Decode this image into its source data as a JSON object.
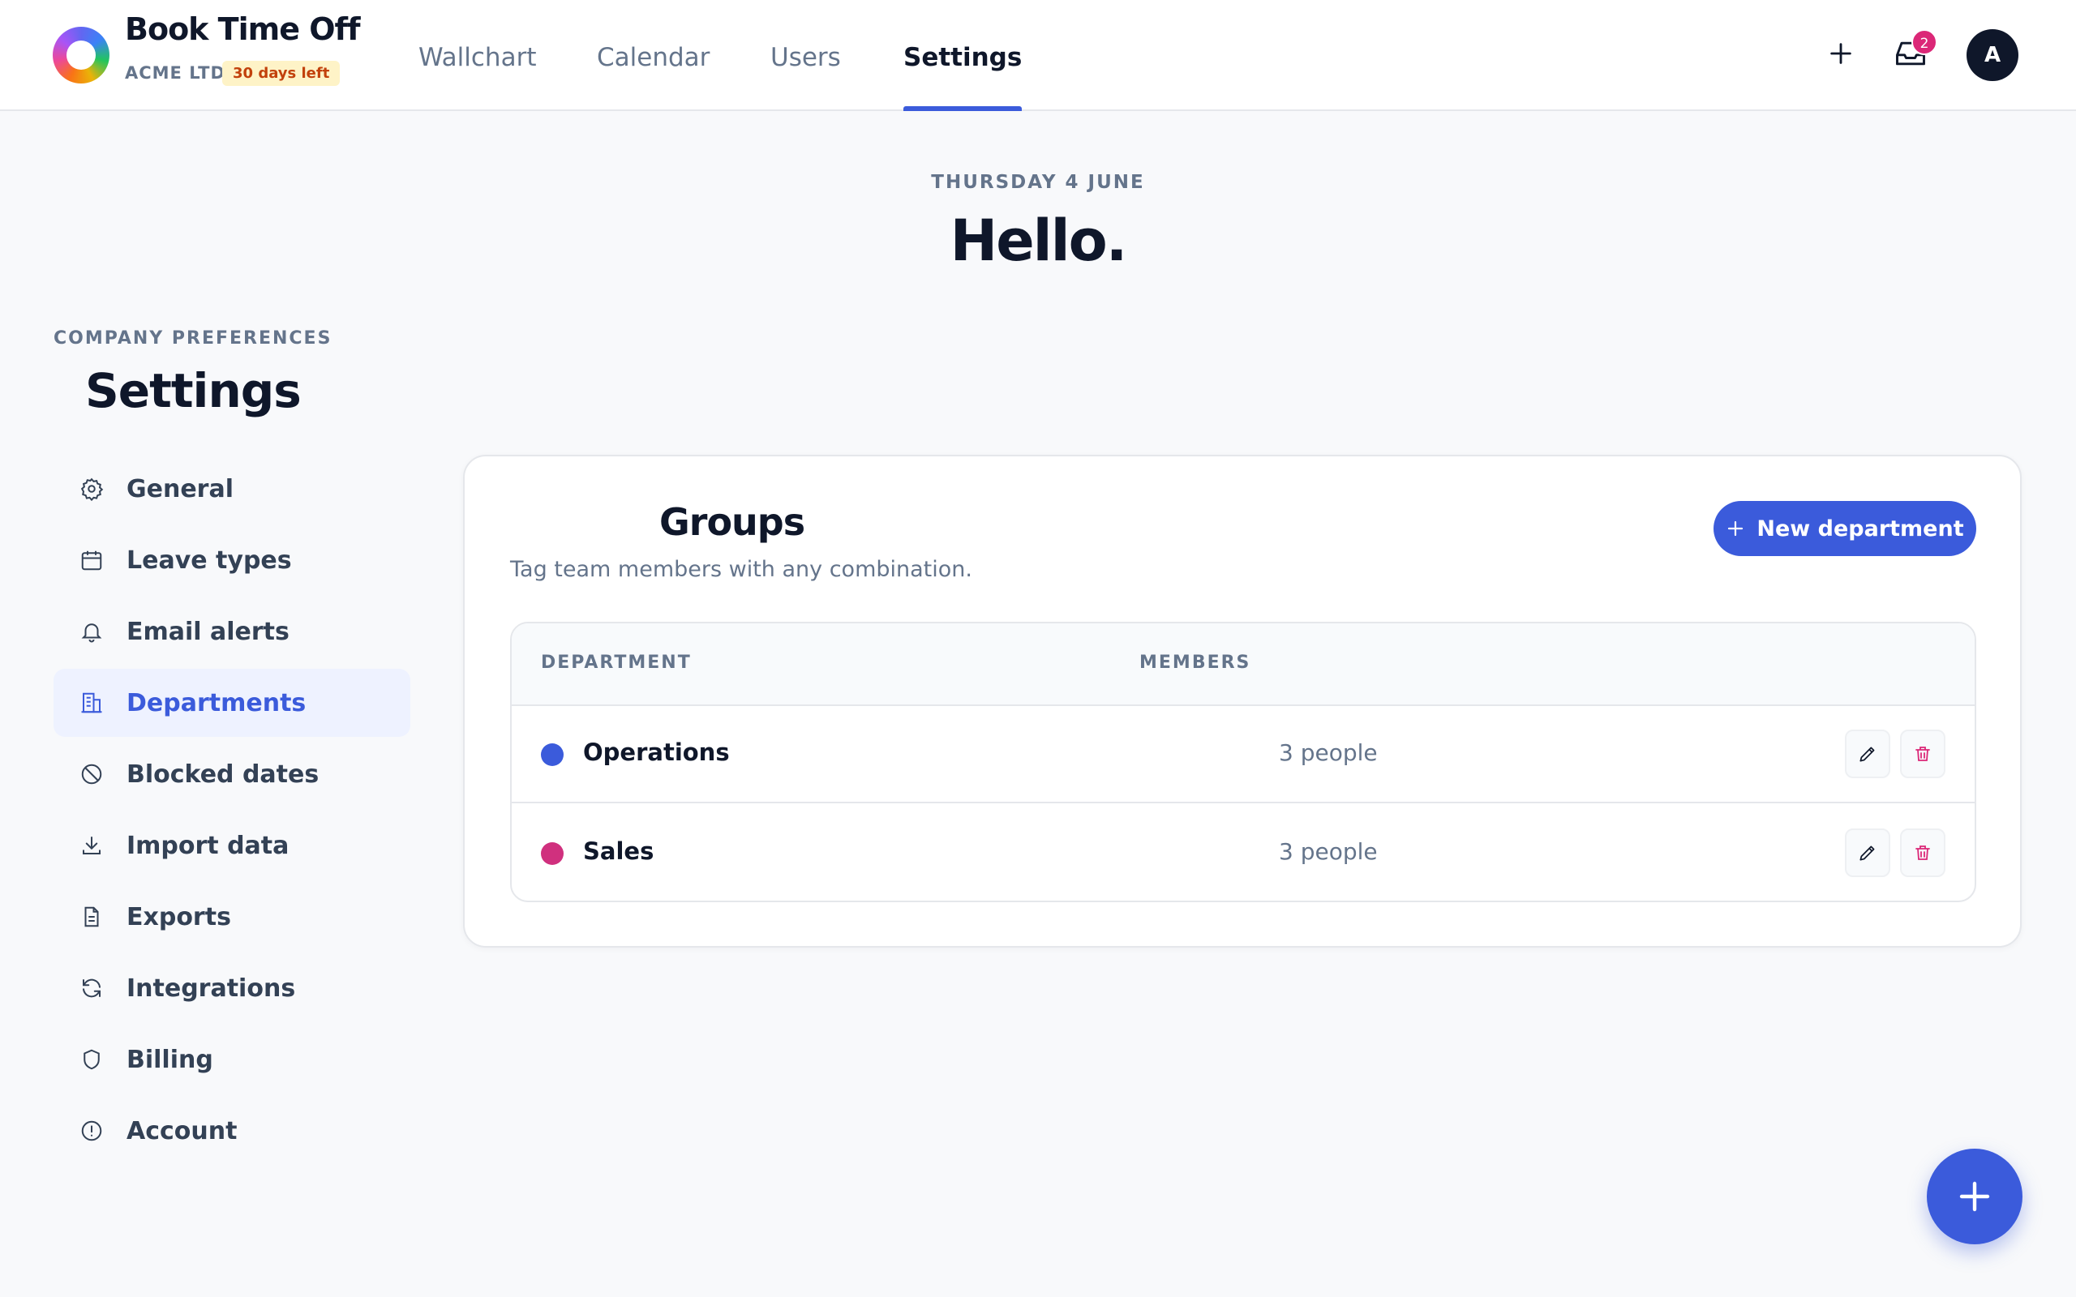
{
  "brand": {
    "name": "Book Time Off",
    "company": "ACME LTD",
    "trial": "30 days left"
  },
  "nav": [
    {
      "label": "Wallchart"
    },
    {
      "label": "Calendar"
    },
    {
      "label": "Users"
    },
    {
      "label": "Settings",
      "active": true
    }
  ],
  "header": {
    "notifications": "2",
    "avatar_initial": "A"
  },
  "greeting": {
    "date": "THURSDAY 4 JUNE",
    "hello": "Hello."
  },
  "settings": {
    "eyebrow": "COMPANY PREFERENCES",
    "title": "Settings",
    "menu": [
      {
        "label": "General",
        "icon": "gear-icon"
      },
      {
        "label": "Leave types",
        "icon": "calendar-icon"
      },
      {
        "label": "Email alerts",
        "icon": "bell-icon"
      },
      {
        "label": "Departments",
        "icon": "building-icon",
        "active": true
      },
      {
        "label": "Blocked dates",
        "icon": "blocked-icon"
      },
      {
        "label": "Import data",
        "icon": "download-icon"
      },
      {
        "label": "Exports",
        "icon": "document-icon"
      },
      {
        "label": "Integrations",
        "icon": "refresh-icon"
      },
      {
        "label": "Billing",
        "icon": "shield-icon"
      },
      {
        "label": "Account",
        "icon": "alert-circle-icon"
      }
    ]
  },
  "groups": {
    "title": "Groups",
    "subtitle": "Tag team members with any combination.",
    "new_button": "New department",
    "columns": [
      "DEPARTMENT",
      "MEMBERS"
    ],
    "rows": [
      {
        "name": "Operations",
        "members": "3 people",
        "color": "#3b5bdb"
      },
      {
        "name": "Sales",
        "members": "3 people",
        "color": "#d0307e"
      }
    ]
  },
  "colors": {
    "accent": "#3b5bdb",
    "danger": "#db2777",
    "badge_bg": "#fef3c7"
  }
}
